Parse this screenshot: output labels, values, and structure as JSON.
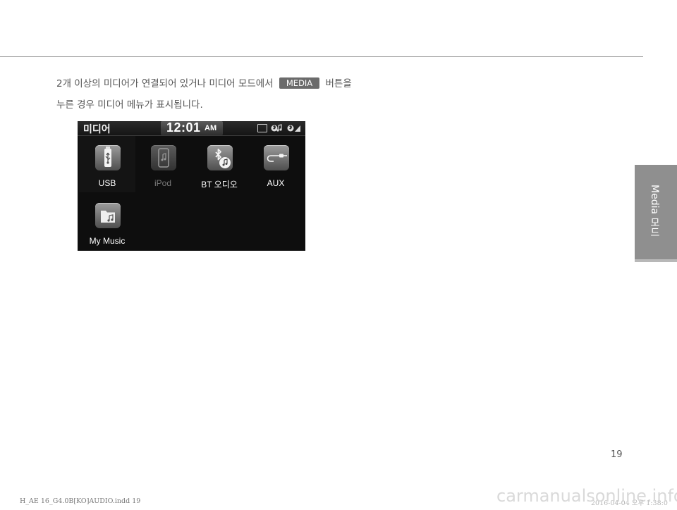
{
  "body": {
    "line1_before": "2개 이상의 미디어가 연결되어 있거나 미디어 모드에서",
    "media_button": "MEDIA",
    "line1_after": "버튼을",
    "line2": "누른 경우 미디어 메뉴가 표시됩니다."
  },
  "screen": {
    "title": "미디어",
    "clock": "12:01",
    "ampm": "AM",
    "items": [
      {
        "label": "USB",
        "icon": "usb-icon",
        "enabled": true
      },
      {
        "label": "iPod",
        "icon": "ipod-icon",
        "enabled": false
      },
      {
        "label": "BT 오디오",
        "icon": "bluetooth-audio-icon",
        "enabled": true
      },
      {
        "label": "AUX",
        "icon": "aux-cable-icon",
        "enabled": true
      },
      {
        "label": "My Music",
        "icon": "folder-music-icon",
        "enabled": true
      }
    ]
  },
  "side_tab": "Media 모드",
  "page_number": "19",
  "footer": {
    "left": "H_AE 16_G4.0B[KO]AUDIO.indd   19",
    "right": "2016-04-04   오후 1:38:0"
  },
  "watermark": "carmanualsonline.info"
}
